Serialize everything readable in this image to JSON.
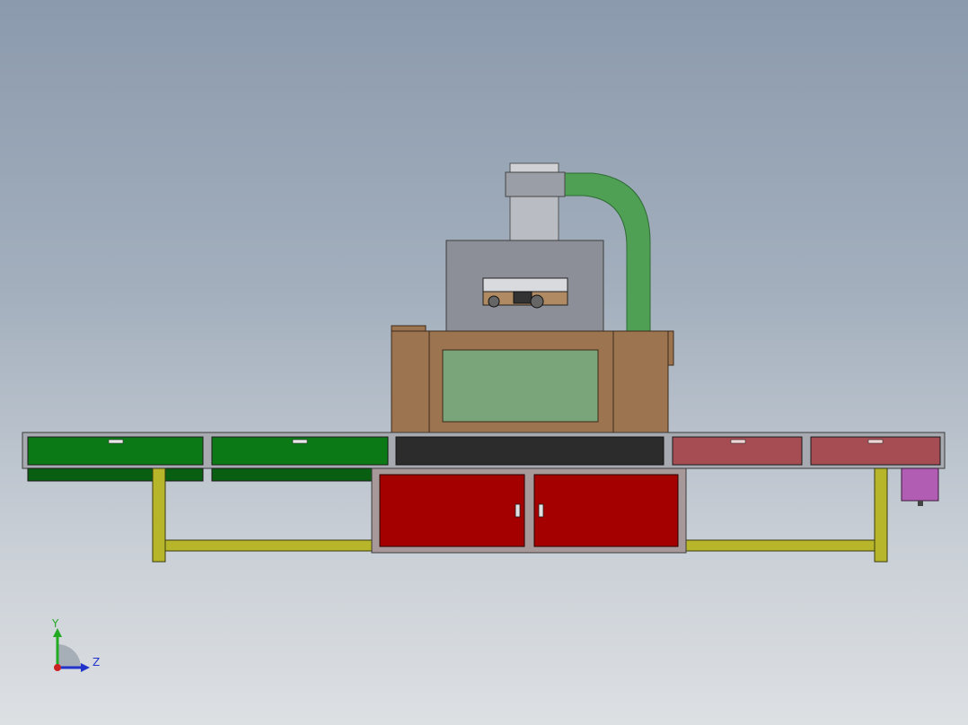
{
  "viewport": {
    "type": "cad-3d-viewport",
    "background_top": "#8b9aad",
    "background_bottom": "#dde0e3"
  },
  "model": {
    "description_icon": "machine-assembly",
    "colors": {
      "fan_housing": "#9a9ea6",
      "fan_cylinder": "#b9bcc2",
      "duct": "#4fa055",
      "hood": "#8c8f97",
      "cabinet_body": "#9c7450",
      "window": "#7aa57a",
      "conveyor_frame": "#a7aab1",
      "green_panel": "#0b7a16",
      "dark_panel": "#2c2c2c",
      "pink_panel": "#a54d53",
      "legs": "#b7b52a",
      "red_door": "#a40000",
      "motor": "#b15db3"
    }
  },
  "triad": {
    "y_label": "Y",
    "z_label": "Z",
    "y_color": "#22aa22",
    "z_color": "#2233cc",
    "x_color": "#cc2222"
  }
}
